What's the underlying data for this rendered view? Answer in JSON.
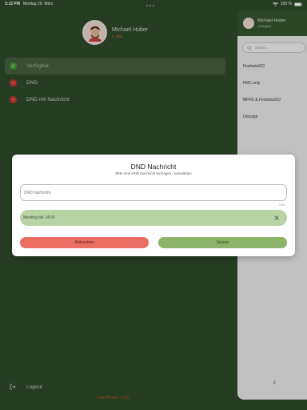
{
  "status_bar": {
    "time": "3:12 PM",
    "date": "Montag 29. März",
    "battery": "100 %"
  },
  "profile": {
    "name": "Michael Huber",
    "status": "5, 356"
  },
  "status_options": [
    {
      "label": "Verfügbar",
      "active": true,
      "color": "#45a035"
    },
    {
      "label": "DND",
      "active": false,
      "color": "#c93a30"
    },
    {
      "label": "DND mit Nachricht",
      "active": false,
      "color": "#c93a30"
    }
  ],
  "sidebar": {
    "logout_label": "Logout",
    "version": "One Phone - 1.0.0"
  },
  "panel": {
    "name": "Michael Huber",
    "status": "Verfügbar",
    "search_placeholder": "Suche...",
    "items": [
      "FestnetzGO",
      "FMC only",
      "MFFD & FestnetzGO",
      "Unicope"
    ],
    "bottom_label": "⫴"
  },
  "modal": {
    "title": "DND Nachricht",
    "subtitle": "Bitte eine DND Nachricht eintragen / auswählen",
    "input_placeholder": "DND Nachricht",
    "char_count": "0/45",
    "suggestion": "Meeting bis 14:00",
    "cancel_label": "Abbrechen",
    "set_label": "Setzen"
  },
  "colors": {
    "background": "#2f4b2b",
    "accent_green": "#8db26a",
    "accent_red": "#ea6e62",
    "orange": "#e0682f"
  }
}
